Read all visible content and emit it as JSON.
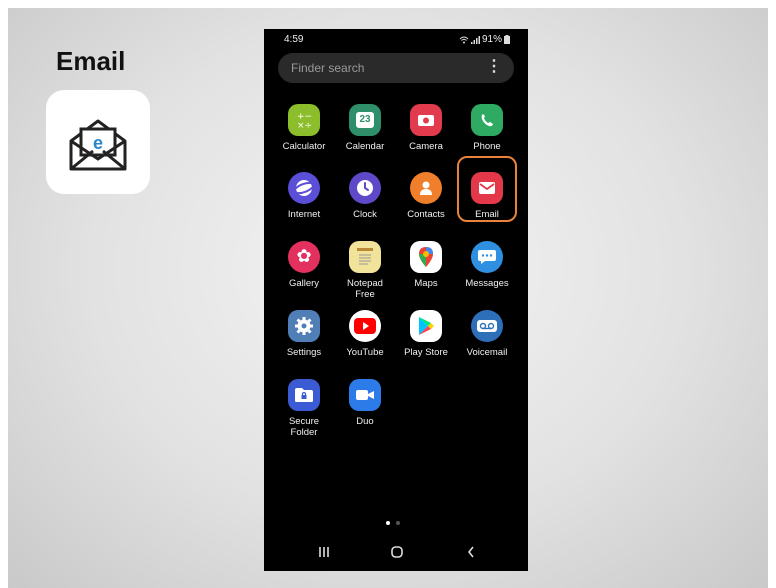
{
  "slide": {
    "title": "Email"
  },
  "status_bar": {
    "time": "4:59",
    "battery": "91%"
  },
  "search": {
    "placeholder": "Finder search"
  },
  "apps": [
    {
      "id": "calculator",
      "label": "Calculator",
      "color": "#8cbd2a"
    },
    {
      "id": "calendar",
      "label": "Calendar",
      "color": "#2e8f6a",
      "icon_text": "23"
    },
    {
      "id": "camera",
      "label": "Camera",
      "color": "#e23b4e"
    },
    {
      "id": "phone",
      "label": "Phone",
      "color": "#2faa63"
    },
    {
      "id": "internet",
      "label": "Internet",
      "color": "#5a4fd6"
    },
    {
      "id": "clock",
      "label": "Clock",
      "color": "#6049c9"
    },
    {
      "id": "contacts",
      "label": "Contacts",
      "color": "#ef7f2a"
    },
    {
      "id": "email",
      "label": "Email",
      "color": "#e3384a",
      "highlighted": true
    },
    {
      "id": "gallery",
      "label": "Gallery",
      "color": "#e2305f"
    },
    {
      "id": "notepad",
      "label": "Notepad Free",
      "color": "#f2e39a"
    },
    {
      "id": "maps",
      "label": "Maps",
      "color": "#ffffff"
    },
    {
      "id": "messages",
      "label": "Messages",
      "color": "#2f8fe0"
    },
    {
      "id": "settings",
      "label": "Settings",
      "color": "#4f7fb6"
    },
    {
      "id": "youtube",
      "label": "YouTube",
      "color": "#ffffff"
    },
    {
      "id": "play-store",
      "label": "Play Store",
      "color": "#ffffff"
    },
    {
      "id": "voicemail",
      "label": "Voicemail",
      "color": "#2d6fb8"
    },
    {
      "id": "secure-folder",
      "label": "Secure Folder",
      "color": "#3a5bd4"
    },
    {
      "id": "duo",
      "label": "Duo",
      "color": "#2d7be8"
    }
  ],
  "page_indicator": {
    "current": 1,
    "total": 2
  },
  "colors": {
    "highlight": "#e9823a",
    "phone_bg": "#000000"
  }
}
